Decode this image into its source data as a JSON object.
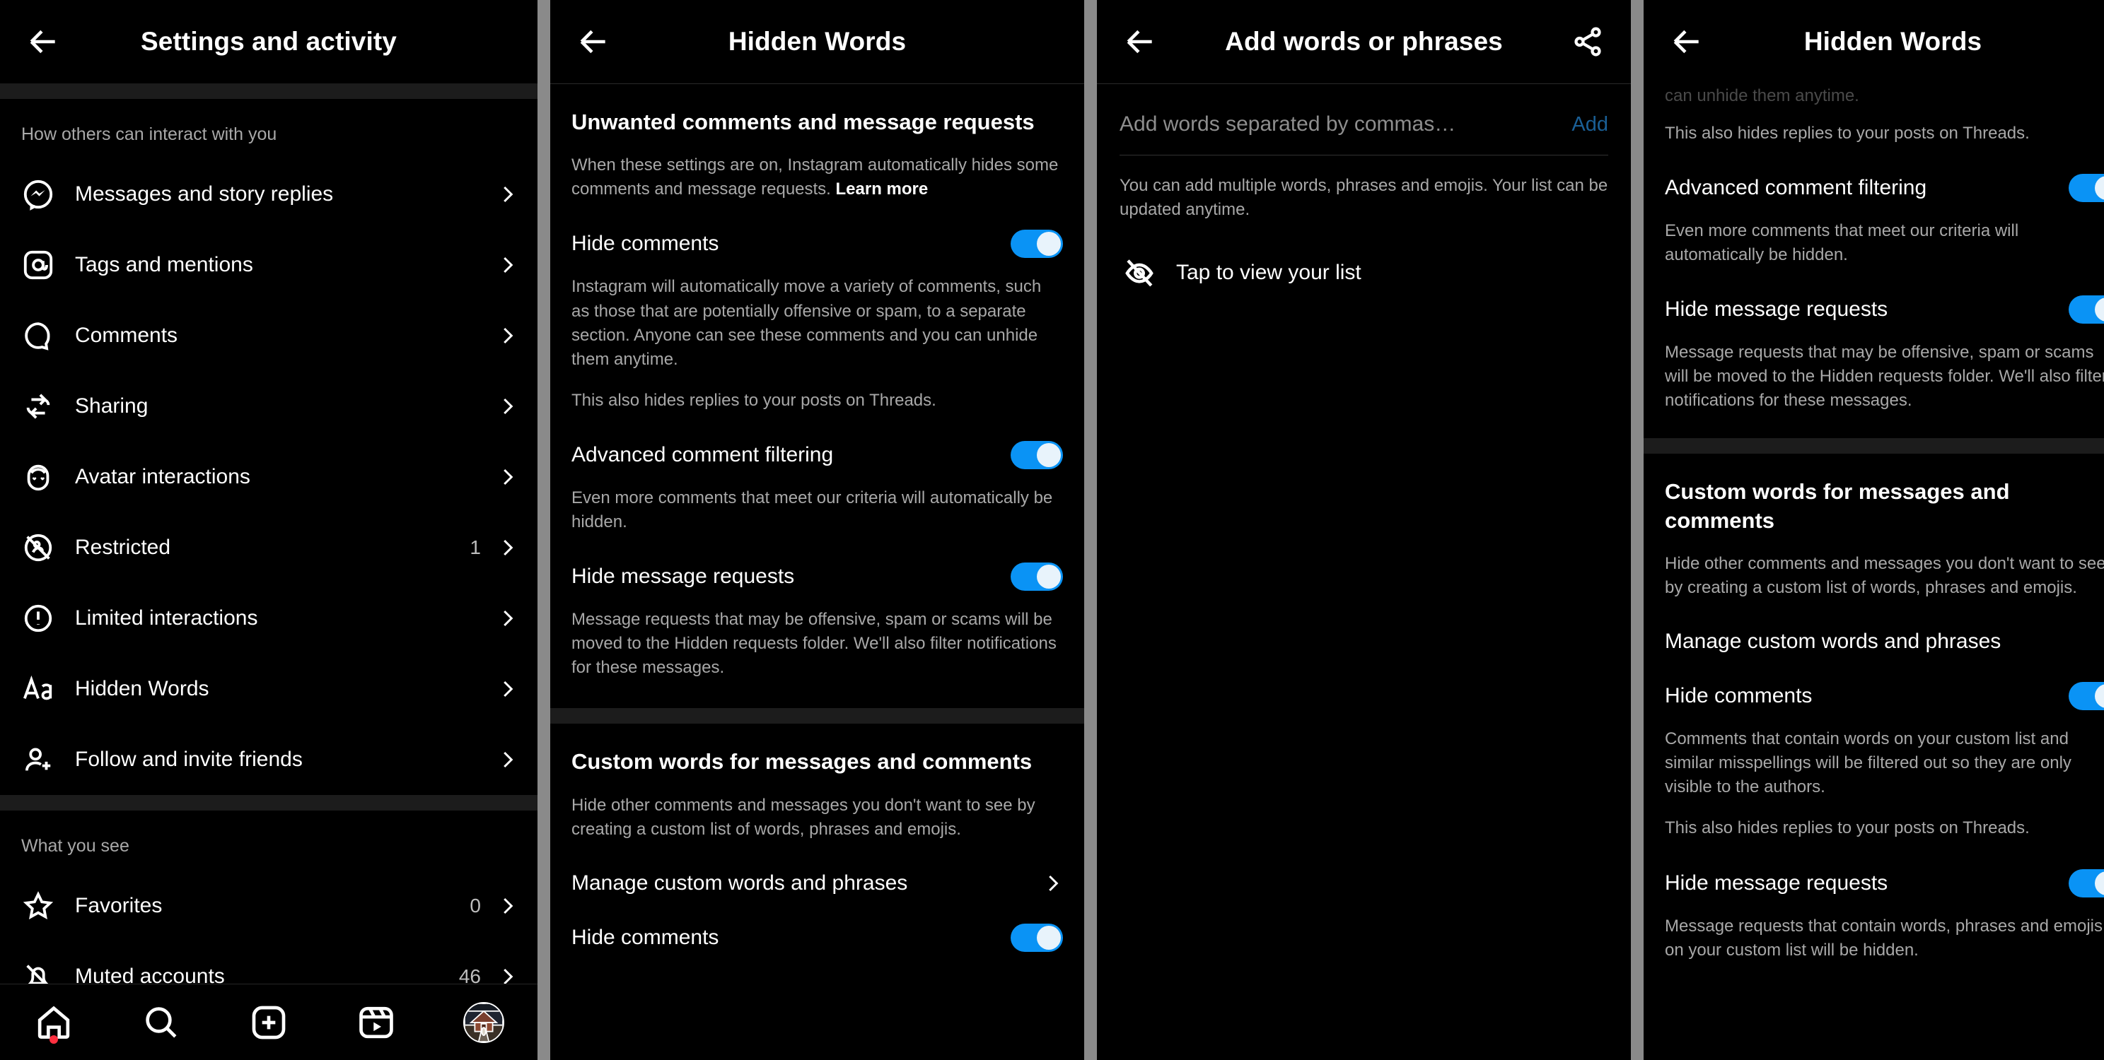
{
  "panels": {
    "settings": {
      "title": "Settings and activity",
      "back_icon": "arrow-left-icon",
      "section1_label": "How others can interact with you",
      "items1": [
        {
          "label": "Messages and story replies",
          "icon": "messenger-icon",
          "count": ""
        },
        {
          "label": "Tags and mentions",
          "icon": "at-icon",
          "count": ""
        },
        {
          "label": "Comments",
          "icon": "comment-bubble-icon",
          "count": ""
        },
        {
          "label": "Sharing",
          "icon": "repost-icon",
          "count": ""
        },
        {
          "label": "Avatar interactions",
          "icon": "avatar-face-icon",
          "count": ""
        },
        {
          "label": "Restricted",
          "icon": "restricted-icon",
          "count": "1"
        },
        {
          "label": "Limited interactions",
          "icon": "exclamation-circle-icon",
          "count": ""
        },
        {
          "label": "Hidden Words",
          "icon": "aa-text-icon",
          "count": ""
        },
        {
          "label": "Follow and invite friends",
          "icon": "person-plus-icon",
          "count": ""
        }
      ],
      "section2_label": "What you see",
      "items2": [
        {
          "label": "Favorites",
          "icon": "star-icon",
          "count": "0"
        },
        {
          "label": "Muted accounts",
          "icon": "bell-off-icon",
          "count": "46"
        }
      ],
      "navbar": [
        {
          "name": "home",
          "icon": "home-icon",
          "badge": true
        },
        {
          "name": "search",
          "icon": "search-icon",
          "badge": false
        },
        {
          "name": "create",
          "icon": "plus-square-icon",
          "badge": false
        },
        {
          "name": "reels",
          "icon": "reels-icon",
          "badge": false
        },
        {
          "name": "profile",
          "icon": "avatar-icon",
          "badge": false
        }
      ]
    },
    "hidden_words": {
      "title": "Hidden Words",
      "back_icon": "arrow-left-icon",
      "section1_heading": "Unwanted comments and message requests",
      "section1_desc": "When these settings are on, Instagram automatically hides some comments and message requests. ",
      "section1_link": "Learn more",
      "toggles1": [
        {
          "label": "Hide comments",
          "on": true,
          "desc": "Instagram will automatically move a variety of comments, such as those that are potentially offensive or spam, to a separate section. Anyone can see these comments and you can unhide them anytime.",
          "desc2": "This also hides replies to your posts on Threads."
        },
        {
          "label": "Advanced comment filtering",
          "on": true,
          "desc": "Even more comments that meet our criteria will automatically be hidden.",
          "desc2": ""
        },
        {
          "label": "Hide message requests",
          "on": true,
          "desc": "Message requests that may be offensive, spam or scams will be moved to the Hidden requests folder. We'll also filter notifications for these messages.",
          "desc2": ""
        }
      ],
      "section2_heading": "Custom words for messages and comments",
      "section2_desc": "Hide other comments and messages you don't want to see by creating a custom list of words, phrases and emojis.",
      "manage_link": "Manage custom words and phrases",
      "toggles2": [
        {
          "label": "Hide comments",
          "on": true
        }
      ]
    },
    "add_words": {
      "title": "Add words or phrases",
      "back_icon": "arrow-left-icon",
      "share_icon": "share-icon",
      "input_placeholder": "Add words separated by commas…",
      "input_value": "",
      "add_label": "Add",
      "hint": "You can add multiple words, phrases and emojis. Your list can be updated anytime.",
      "view_list_label": "Tap to view your list",
      "view_list_icon": "eye-off-icon"
    },
    "hidden_words_scrolled": {
      "title": "Hidden Words",
      "back_icon": "arrow-left-icon",
      "clipped_text": "can unhide them anytime.",
      "threads_note": "This also hides replies to your posts on Threads.",
      "toggles": [
        {
          "label": "Advanced comment filtering",
          "on": true,
          "desc": "Even more comments that meet our criteria will automatically be hidden."
        },
        {
          "label": "Hide message requests",
          "on": true,
          "desc": "Message requests that may be offensive, spam or scams will be moved to the Hidden requests folder. We'll also filter notifications for these messages."
        }
      ],
      "section2_heading": "Custom words for messages and comments",
      "section2_desc": "Hide other comments and messages you don't want to see by creating a custom list of words, phrases and emojis.",
      "manage_link": "Manage custom words and phrases",
      "toggles2": [
        {
          "label": "Hide comments",
          "on": true,
          "desc": "Comments that contain words on your custom list and similar misspellings will be filtered out so they are only visible to the authors.",
          "desc2": "This also hides replies to your posts on Threads."
        },
        {
          "label": "Hide message requests",
          "on": true,
          "desc": "Message requests that contain words, phrases and emojis on your custom list will be hidden.",
          "desc2": ""
        }
      ]
    }
  },
  "colors": {
    "background": "#000000",
    "toggle_on": "#0a93f5",
    "text_primary": "#ffffff",
    "text_secondary": "#a8a8a8",
    "add_disabled": "#1a5f96",
    "badge_red": "#ff3040",
    "divider": "#1c1c1c",
    "gutter": "#8a8a8a"
  }
}
